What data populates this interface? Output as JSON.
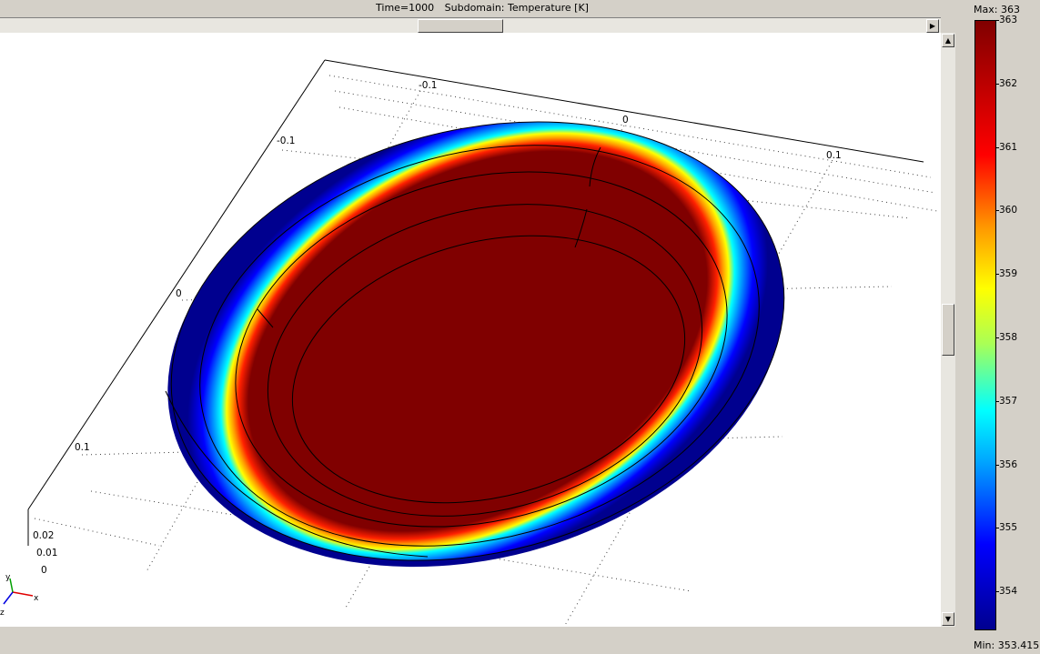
{
  "header": {
    "time_label": "Time=1000",
    "subdomain_label": "Subdomain: Temperature [K]"
  },
  "axes": {
    "top_ticks": [
      "-0.1",
      "0",
      "0.1"
    ],
    "left_ticks": [
      "-0.1",
      "0",
      "0.1"
    ],
    "z_ticks": [
      "0.02",
      "0.01",
      "0"
    ],
    "triad": {
      "x": "x",
      "y": "y",
      "z": "z"
    }
  },
  "colorbar": {
    "max_label": "Max: 363",
    "min_label": "Min: 353.415",
    "ticks": [
      "363",
      "362",
      "361",
      "360",
      "359",
      "358",
      "357",
      "356",
      "355",
      "354"
    ],
    "colors": {
      "low": "#00008f",
      "high": "#800000"
    }
  },
  "scrollbars": {
    "up": "▲",
    "down": "▼",
    "right": "▶"
  }
}
